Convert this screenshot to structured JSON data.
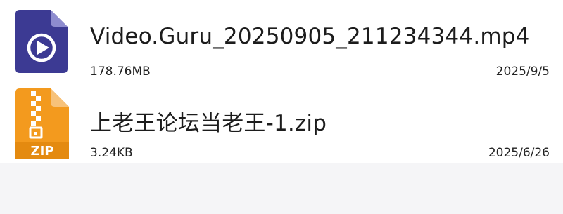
{
  "files": [
    {
      "name": "Video.Guru_20250905_211234344.mp4",
      "size": "178.76MB",
      "date": "2025/9/5",
      "icon": "video-file-icon",
      "icon_color": "#3c3a93"
    },
    {
      "name": "上老王论坛当老王-1.zip",
      "size": "3.24KB",
      "date": "2025/6/26",
      "icon": "zip-file-icon",
      "icon_color": "#f39a1e",
      "icon_label": "ZIP"
    }
  ]
}
